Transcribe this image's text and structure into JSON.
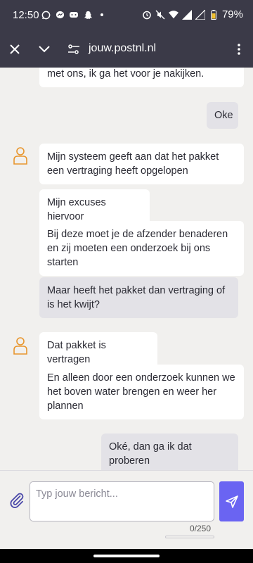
{
  "status": {
    "time": "12:50",
    "battery": "79%"
  },
  "browser": {
    "url": "jouw.postnl.nl"
  },
  "chat": {
    "messages": [
      {
        "from": "agent",
        "text": "met ons, ik ga het voor je nakijken."
      },
      {
        "from": "user",
        "text": "Oke"
      },
      {
        "from": "agent",
        "text": "Mijn systeem geeft aan dat het pakket een vertraging heeft opgelopen"
      },
      {
        "from": "agent",
        "text": "Mijn excuses hiervoor"
      },
      {
        "from": "agent",
        "text": "Bij deze moet je de afzender benaderen en zij moeten een onderzoek bij ons starten"
      },
      {
        "from": "user",
        "text": "Maar heeft het pakket dan vertraging of is het kwijt?"
      },
      {
        "from": "agent",
        "text": "Dat pakket is vertragen"
      },
      {
        "from": "agent",
        "text": "En alleen door een onderzoek kunnen we het boven water brengen en weer her plannen"
      },
      {
        "from": "user",
        "text": "Oké, dan ga ik dat proberen"
      }
    ]
  },
  "composer": {
    "placeholder": "Typ jouw bericht...",
    "value": "",
    "counter": "0/250"
  },
  "colors": {
    "toolbar": "#3b3a48",
    "accent": "#6a64f2",
    "avatar": "#e8962e",
    "user_bubble": "#e3e2e7"
  }
}
